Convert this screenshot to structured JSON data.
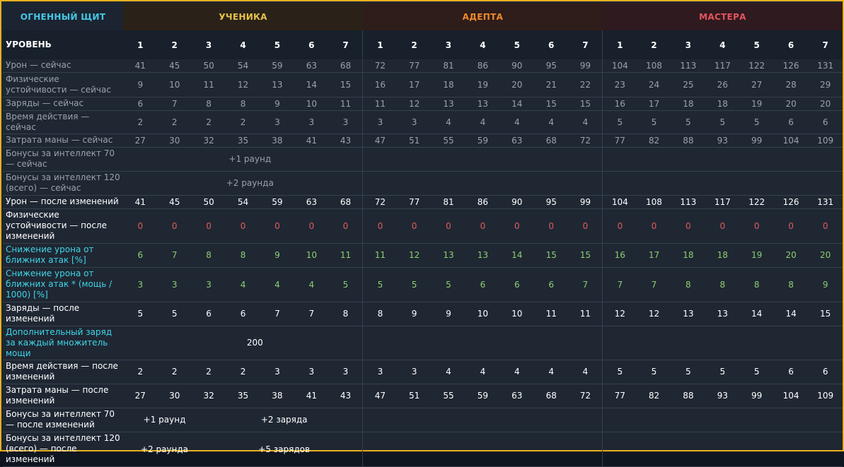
{
  "header": {
    "spell": "ОГНЕННЫЙ ЩИТ",
    "tiers": [
      "УЧЕНИКА",
      "АДЕПТА",
      "МАСТЕРА"
    ]
  },
  "levels_label": "УРОВЕНЬ",
  "levels": [
    1,
    2,
    3,
    4,
    5,
    6,
    7,
    1,
    2,
    3,
    4,
    5,
    6,
    7,
    1,
    2,
    3,
    4,
    5,
    6,
    7
  ],
  "rows": {
    "dmg_old": {
      "label": "Урон — сейчас",
      "values": [
        41,
        45,
        50,
        54,
        59,
        63,
        68,
        72,
        77,
        81,
        86,
        90,
        95,
        99,
        104,
        108,
        113,
        117,
        122,
        126,
        131
      ]
    },
    "res_old": {
      "label": "Физические устойчивости — сейчас",
      "values": [
        9,
        10,
        11,
        12,
        13,
        14,
        15,
        16,
        17,
        18,
        19,
        20,
        21,
        22,
        23,
        24,
        25,
        26,
        27,
        28,
        29
      ]
    },
    "charges_old": {
      "label": "Заряды — сейчас",
      "values": [
        6,
        7,
        8,
        8,
        9,
        10,
        11,
        11,
        12,
        13,
        13,
        14,
        15,
        15,
        16,
        17,
        18,
        18,
        19,
        20,
        20
      ]
    },
    "dur_old": {
      "label": "Время действия — сейчас",
      "values": [
        2,
        2,
        2,
        2,
        3,
        3,
        3,
        3,
        3,
        4,
        4,
        4,
        4,
        4,
        5,
        5,
        5,
        5,
        5,
        6,
        6
      ]
    },
    "mana_old": {
      "label": "Затрата маны — сейчас",
      "values": [
        27,
        30,
        32,
        35,
        38,
        41,
        43,
        47,
        51,
        55,
        59,
        63,
        68,
        72,
        77,
        82,
        88,
        93,
        99,
        104,
        109
      ]
    },
    "int70_old": {
      "label": "Бонусы за интеллект 70 — сейчас",
      "v1": "+1 раунд"
    },
    "int120_old": {
      "label": "Бонусы за интеллект 120 (всего) — сейчас",
      "v1": "+2 раунда"
    },
    "dmg_new": {
      "label": "Урон — после изменений",
      "values": [
        41,
        45,
        50,
        54,
        59,
        63,
        68,
        72,
        77,
        81,
        86,
        90,
        95,
        99,
        104,
        108,
        113,
        117,
        122,
        126,
        131
      ]
    },
    "res_new": {
      "label": "Физические устойчивости — после изменений",
      "values": [
        0,
        0,
        0,
        0,
        0,
        0,
        0,
        0,
        0,
        0,
        0,
        0,
        0,
        0,
        0,
        0,
        0,
        0,
        0,
        0,
        0
      ]
    },
    "melee_red": {
      "label": "Снижение урона от ближних атак [%]",
      "values": [
        6,
        7,
        8,
        8,
        9,
        10,
        11,
        11,
        12,
        13,
        13,
        14,
        15,
        15,
        16,
        17,
        18,
        18,
        19,
        20,
        20
      ]
    },
    "melee_red_pow": {
      "label": "Снижение урона от ближних атак * (мощь / 1000) [%]",
      "values": [
        3,
        3,
        3,
        4,
        4,
        4,
        5,
        5,
        5,
        5,
        6,
        6,
        6,
        7,
        7,
        7,
        8,
        8,
        8,
        8,
        9
      ]
    },
    "charges_new": {
      "label": "Заряды — после изменений",
      "values": [
        5,
        5,
        6,
        6,
        7,
        7,
        8,
        8,
        9,
        9,
        10,
        10,
        11,
        11,
        12,
        12,
        13,
        13,
        14,
        14,
        15
      ]
    },
    "extra_charge": {
      "label": "Дополнительный заряд за каждый множитель мощи",
      "v1": "200"
    },
    "dur_new": {
      "label": "Время действия — после изменений",
      "values": [
        2,
        2,
        2,
        2,
        3,
        3,
        3,
        3,
        3,
        4,
        4,
        4,
        4,
        4,
        5,
        5,
        5,
        5,
        5,
        6,
        6
      ]
    },
    "mana_new": {
      "label": "Затрата маны — после изменений",
      "values": [
        27,
        30,
        32,
        35,
        38,
        41,
        43,
        47,
        51,
        55,
        59,
        63,
        68,
        72,
        77,
        82,
        88,
        93,
        99,
        104,
        109
      ]
    },
    "int70_new": {
      "label": "Бонусы за интеллект 70 — после изменений",
      "v1": "+1 раунд",
      "v2": "+2 заряда"
    },
    "int120_new": {
      "label": "Бонусы за интеллект 120 (всего) — после изменений",
      "v1": "+2 раунда",
      "v2": "+5 зарядов"
    }
  }
}
